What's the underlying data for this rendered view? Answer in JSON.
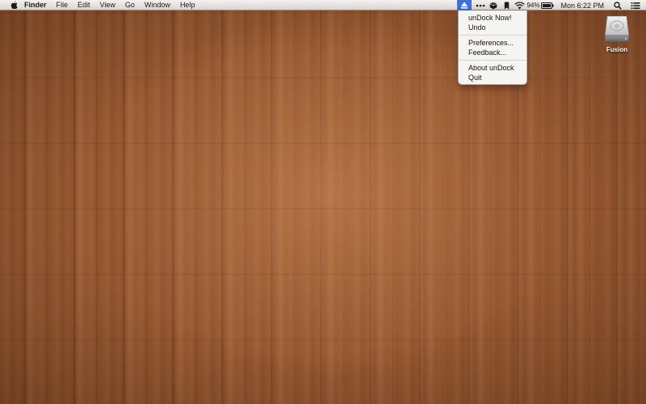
{
  "menubar": {
    "apple_icon": "apple-logo-icon",
    "app_name": "Finder",
    "menus": [
      "File",
      "Edit",
      "View",
      "Go",
      "Window",
      "Help"
    ],
    "status": {
      "undock_icon": "eject-triangle-icon",
      "icons": [
        "ellipsis-icon",
        "dropbox-icon",
        "bookmark-icon",
        "wifi-icon"
      ],
      "battery_percent": "94%",
      "clock": "Mon 6:22 PM",
      "spotlight_icon": "magnifier-icon",
      "notifications_icon": "list-icon"
    },
    "accent_color": "#3f6fd8"
  },
  "dropdown": {
    "groups": [
      [
        "unDock Now!",
        "Undo"
      ],
      [
        "Preferences...",
        "Feedback..."
      ],
      [
        "About unDock",
        "Quit"
      ]
    ]
  },
  "desktop": {
    "disk": {
      "label": "Fusion",
      "icon": "hard-drive-icon"
    }
  }
}
